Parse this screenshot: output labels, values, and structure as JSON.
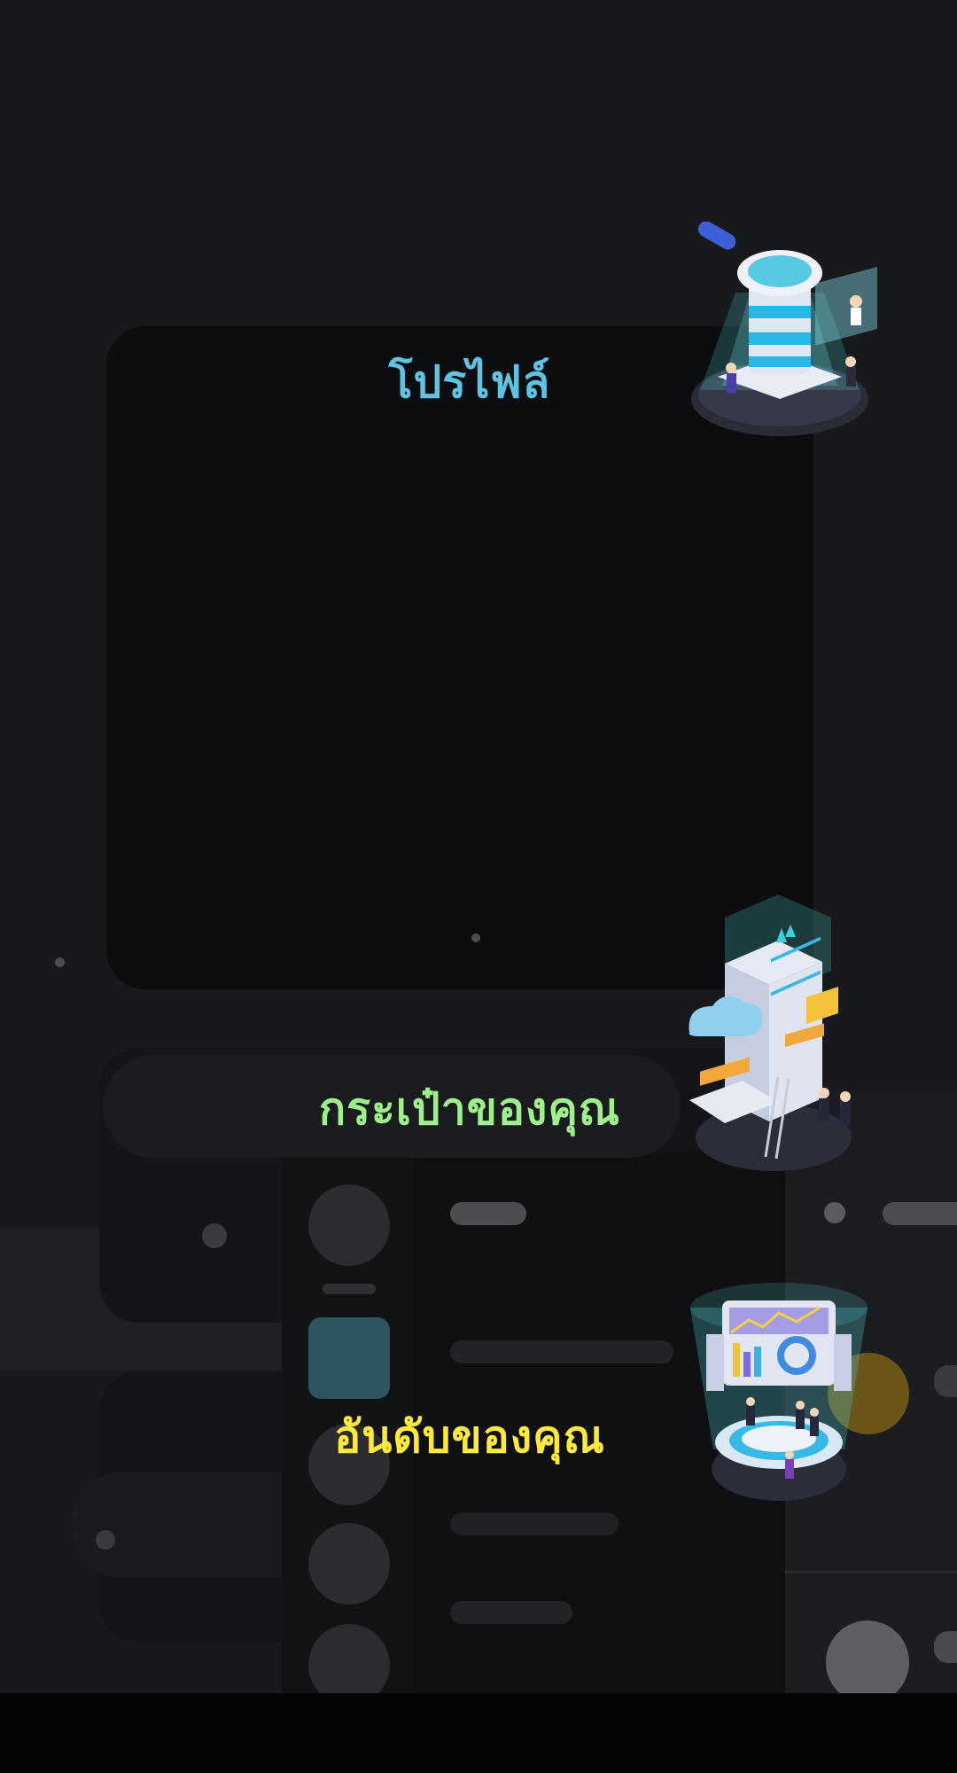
{
  "sections": {
    "profile": {
      "title": "โปรไฟล์",
      "color": "#5fc3e4",
      "icon": "magnifier-database-icon"
    },
    "wallet": {
      "title": "กระเป๋าของคุณ",
      "color": "#9ef08a",
      "icon": "server-cloud-icon"
    },
    "ranking": {
      "title": "อันดับของคุณ",
      "color": "#ffe93a",
      "icon": "dashboard-screens-icon"
    }
  }
}
